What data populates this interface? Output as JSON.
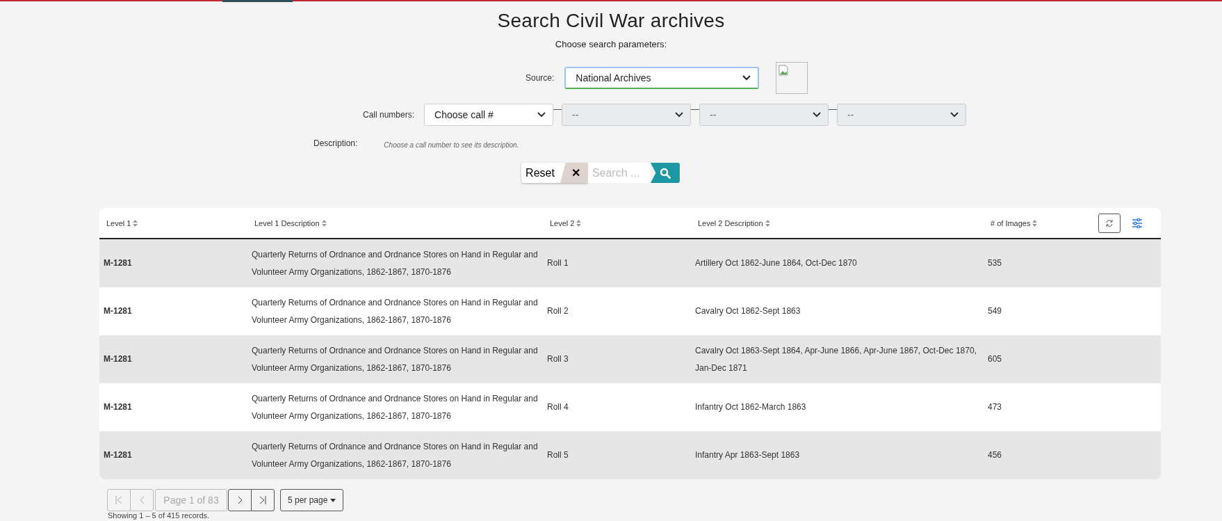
{
  "title": "Search Civil War archives",
  "subtitle": "Choose search parameters:",
  "source": {
    "label": "Source:",
    "value": "National Archives"
  },
  "call_numbers": {
    "label": "Call numbers:",
    "selects": [
      {
        "value": "Choose call #",
        "disabled": false
      },
      {
        "value": "--",
        "disabled": true
      },
      {
        "value": "--",
        "disabled": true
      },
      {
        "value": "--",
        "disabled": true
      }
    ]
  },
  "description": {
    "label": "Description:",
    "hint": "Choose a call number to see its description."
  },
  "reset": {
    "label": "Reset",
    "icon": "✕"
  },
  "search": {
    "placeholder": "Search ..."
  },
  "table": {
    "columns": [
      "Level 1",
      "Level 1 Description",
      "Level 2",
      "Level 2 Description",
      "# of Images"
    ],
    "rows": [
      {
        "cells": [
          "M-1281",
          "Quarterly Returns of Ordnance and Ordnance Stores on Hand in Regular and Volunteer Army Organizations, 1862-1867, 1870-1876",
          "Roll 1",
          "Artillery Oct 1862-June 1864, Oct-Dec 1870",
          "535"
        ]
      },
      {
        "cells": [
          "M-1281",
          "Quarterly Returns of Ordnance and Ordnance Stores on Hand in Regular and Volunteer Army Organizations, 1862-1867, 1870-1876",
          "Roll 2",
          "Cavalry Oct 1862-Sept 1863",
          "549"
        ]
      },
      {
        "cells": [
          "M-1281",
          "Quarterly Returns of Ordnance and Ordnance Stores on Hand in Regular and Volunteer Army Organizations, 1862-1867, 1870-1876",
          "Roll 3",
          "Cavalry Oct 1863-Sept 1864, Apr-June 1866, Apr-June 1867, Oct-Dec 1870, Jan-Dec 1871",
          "605"
        ]
      },
      {
        "cells": [
          "M-1281",
          "Quarterly Returns of Ordnance and Ordnance Stores on Hand in Regular and Volunteer Army Organizations, 1862-1867, 1870-1876",
          "Roll 4",
          "Infantry Oct 1862-March 1863",
          "473"
        ]
      },
      {
        "cells": [
          "M-1281",
          "Quarterly Returns of Ordnance and Ordnance Stores on Hand in Regular and Volunteer Army Organizations, 1862-1867, 1870-1876",
          "Roll 5",
          "Infantry Apr 1863-Sept 1863",
          "456"
        ]
      }
    ]
  },
  "pagination": {
    "buttons": [
      {
        "kind": "first",
        "disabled": true
      },
      {
        "kind": "prev",
        "disabled": true
      },
      {
        "kind": "page",
        "label": "Page 1 of 83",
        "disabled": true
      },
      {
        "kind": "next",
        "disabled": false
      },
      {
        "kind": "last",
        "disabled": false
      }
    ],
    "per_page": "5 per page",
    "showing": "Showing 1 – 5 of 415 records."
  }
}
